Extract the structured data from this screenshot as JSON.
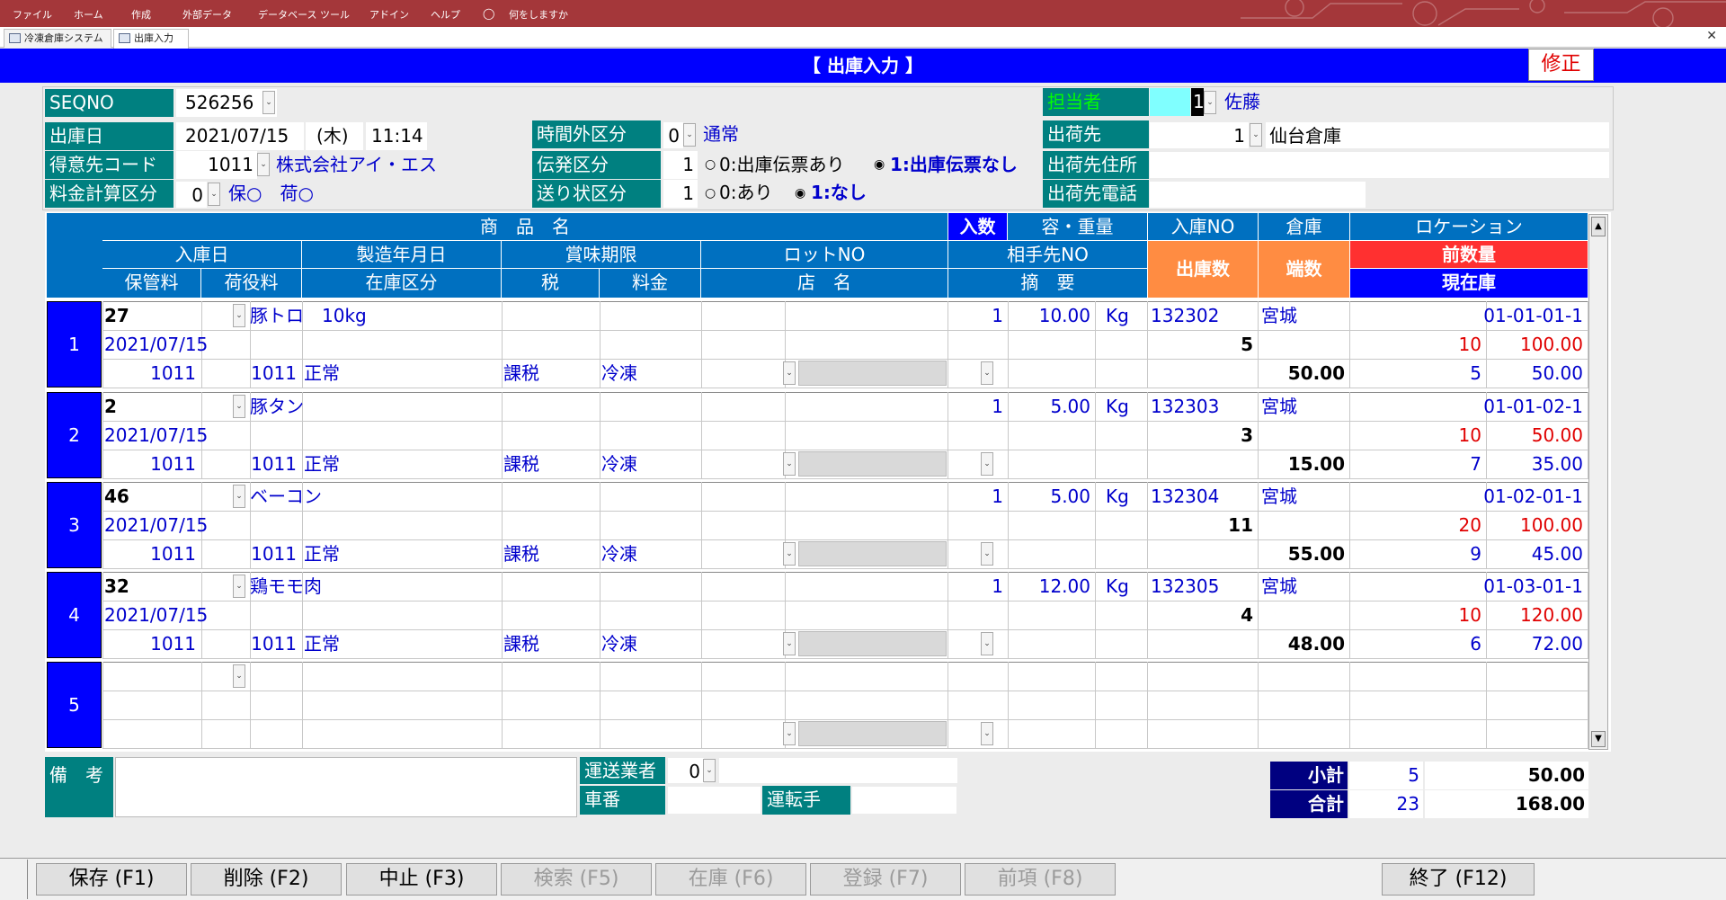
{
  "menu": [
    "ファイル",
    "ホーム",
    "作成",
    "外部データ",
    "データベース ツール",
    "アドイン",
    "ヘルプ",
    "何をしますか"
  ],
  "tabs": [
    "冷凍倉庫システム",
    "出庫入力"
  ],
  "form": {
    "title": "【 出庫入力 】",
    "mode": "修正"
  },
  "header": {
    "seqno_label": "SEQNO",
    "seqno": "526256",
    "date_label": "出庫日",
    "date": "2021/07/15",
    "weekday": "(木)",
    "time": "11:14",
    "customer_label": "得意先コード",
    "customer_code": "1011",
    "customer_name": "株式会社アイ・エス",
    "fee_label": "料金計算区分",
    "fee_code": "0",
    "fee_text": "保○　荷○",
    "overtime_label": "時間外区分",
    "overtime_code": "0",
    "overtime_text": "通常",
    "slip_label": "伝発区分",
    "slip_code": "1",
    "slip_opt0": "0:出庫伝票あり",
    "slip_opt1": "1:出庫伝票なし",
    "invoice_label": "送り状区分",
    "invoice_code": "1",
    "invoice_opt0": "0:あり",
    "invoice_opt1": "1:なし",
    "staff_label": "担当者",
    "staff_code": "1",
    "staff_name": "佐藤",
    "dest_label": "出荷先",
    "dest_code": "1",
    "dest_name": "仙台倉庫",
    "dest_addr_label": "出荷先住所",
    "dest_addr": "",
    "dest_tel_label": "出荷先電話",
    "dest_tel": ""
  },
  "grid_headers": {
    "product": "商　品　名",
    "qty_per": "入数",
    "vol": "容・重量",
    "in_no": "入庫NO",
    "warehouse": "倉庫",
    "location": "ロケーション",
    "in_date": "入庫日",
    "mfg_date": "製造年月日",
    "expiry": "賞味期限",
    "lot": "ロットNO",
    "partner": "相手先NO",
    "out_qty": "出庫数",
    "fraction": "端数",
    "prev_qty": "前数量",
    "storage_fee": "保管料",
    "handling_fee": "荷役料",
    "stock_class": "在庫区分",
    "tax": "税",
    "charge": "料金",
    "store": "店　名",
    "note": "摘　要",
    "current_stock": "現在庫"
  },
  "rows": [
    {
      "no": "1",
      "code": "27",
      "name": "豚トロ　10kg",
      "qty_per": "1",
      "weight": "10.00",
      "unit": "Kg",
      "in_no": "132302",
      "warehouse": "宮城",
      "location": "01-01-01-1",
      "in_date": "2021/07/15",
      "out_qty": "5",
      "prev_fraction": "10",
      "prev_qty": "100.00",
      "storage": "1011",
      "handling": "1011",
      "stock_class": "正常",
      "tax": "課税",
      "charge": "冷凍",
      "out_total": "50.00",
      "cur_count": "5",
      "cur_qty": "50.00"
    },
    {
      "no": "2",
      "code": "2",
      "name": "豚タン",
      "qty_per": "1",
      "weight": "5.00",
      "unit": "Kg",
      "in_no": "132303",
      "warehouse": "宮城",
      "location": "01-01-02-1",
      "in_date": "2021/07/15",
      "out_qty": "3",
      "prev_fraction": "10",
      "prev_qty": "50.00",
      "storage": "1011",
      "handling": "1011",
      "stock_class": "正常",
      "tax": "課税",
      "charge": "冷凍",
      "out_total": "15.00",
      "cur_count": "7",
      "cur_qty": "35.00"
    },
    {
      "no": "3",
      "code": "46",
      "name": "ベーコン",
      "qty_per": "1",
      "weight": "5.00",
      "unit": "Kg",
      "in_no": "132304",
      "warehouse": "宮城",
      "location": "01-02-01-1",
      "in_date": "2021/07/15",
      "out_qty": "11",
      "prev_fraction": "20",
      "prev_qty": "100.00",
      "storage": "1011",
      "handling": "1011",
      "stock_class": "正常",
      "tax": "課税",
      "charge": "冷凍",
      "out_total": "55.00",
      "cur_count": "9",
      "cur_qty": "45.00"
    },
    {
      "no": "4",
      "code": "32",
      "name": "鶏モモ肉",
      "qty_per": "1",
      "weight": "12.00",
      "unit": "Kg",
      "in_no": "132305",
      "warehouse": "宮城",
      "location": "01-03-01-1",
      "in_date": "2021/07/15",
      "out_qty": "4",
      "prev_fraction": "10",
      "prev_qty": "120.00",
      "storage": "1011",
      "handling": "1011",
      "stock_class": "正常",
      "tax": "課税",
      "charge": "冷凍",
      "out_total": "48.00",
      "cur_count": "6",
      "cur_qty": "72.00"
    },
    {
      "no": "5"
    }
  ],
  "footer": {
    "remarks_label": "備　考",
    "remarks": "",
    "carrier_label": "運送業者",
    "carrier_code": "0",
    "carrier_name": "",
    "car_no_label": "車番",
    "car_no": "",
    "driver_label": "運転手",
    "driver": "",
    "subtotal_label": "小計",
    "subtotal_count": "5",
    "subtotal_qty": "50.00",
    "total_label": "合計",
    "total_count": "23",
    "total_qty": "168.00"
  },
  "fkeys": [
    {
      "label": "保存 (F1)",
      "enabled": true
    },
    {
      "label": "削除 (F2)",
      "enabled": true
    },
    {
      "label": "中止 (F3)",
      "enabled": true
    },
    {
      "label": "検索 (F5)",
      "enabled": false
    },
    {
      "label": "在庫 (F6)",
      "enabled": false
    },
    {
      "label": "登録 (F7)",
      "enabled": false
    },
    {
      "label": "前項 (F8)",
      "enabled": false
    },
    {
      "label": "終了 (F12)",
      "enabled": true
    }
  ],
  "colors": {
    "menubar": "#a4373a",
    "title": "#0000ff",
    "header": "#0070c0",
    "label": "#008080",
    "out_qty_header": "#ff8c42",
    "prev_header": "#ff3030",
    "rowhead": "#0000ff"
  }
}
